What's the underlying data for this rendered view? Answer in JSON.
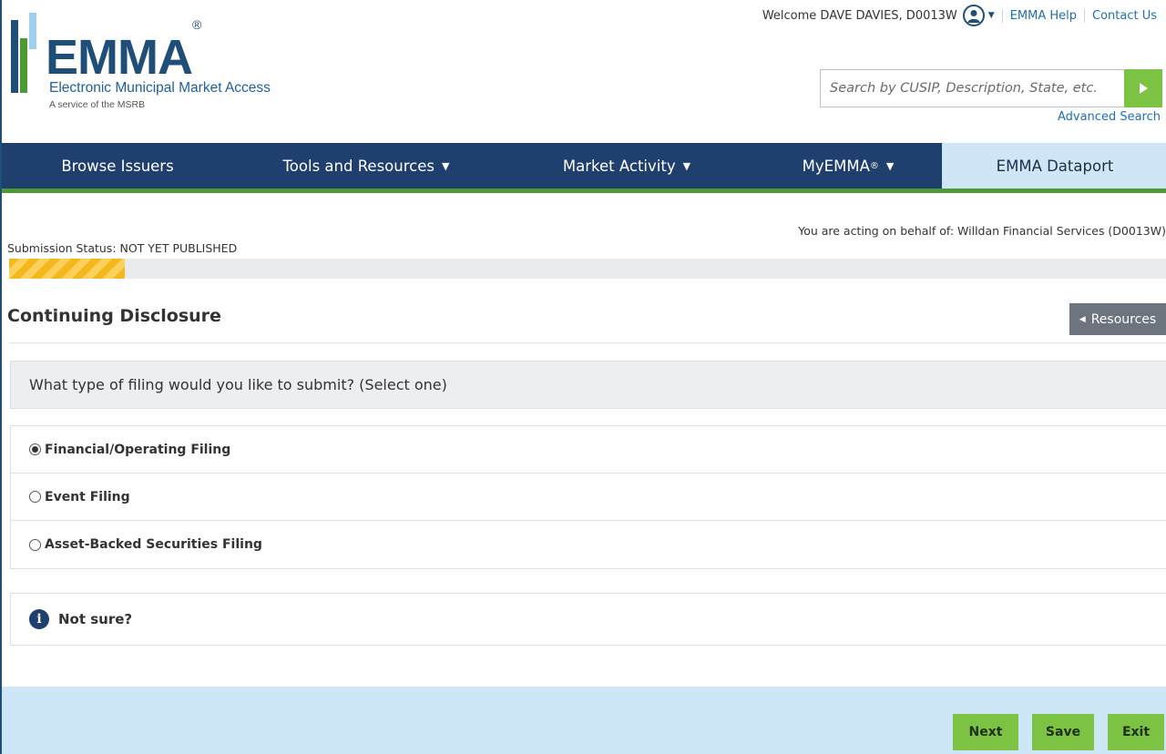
{
  "header": {
    "logo_text": "EMMA",
    "logo_reg": "®",
    "logo_subtitle": "Electronic Municipal Market Access",
    "logo_tagline": "A service of the MSRB",
    "welcome": "Welcome DAVE DAVIES, D0013W",
    "links": [
      "EMMA Help",
      "Contact Us"
    ],
    "search_placeholder": "Search by CUSIP, Description, State, etc.",
    "advanced_search": "Advanced Search"
  },
  "nav": {
    "items": [
      {
        "label": "Browse Issuers",
        "dropdown": false
      },
      {
        "label": "Tools and Resources",
        "dropdown": true
      },
      {
        "label": "Market Activity",
        "dropdown": true
      },
      {
        "label": "MyEMMA",
        "sup": "®",
        "dropdown": true
      },
      {
        "label": "EMMA Dataport",
        "dropdown": false,
        "active": true
      }
    ],
    "dropdown_glyph": "▼"
  },
  "behalf": "You are acting on behalf of: Willdan Financial Services (D0013W)",
  "submission": {
    "status": "Submission Status: NOT YET PUBLISHED",
    "progress_fraction": 0.1
  },
  "section": {
    "title": "Continuing Disclosure",
    "resources_label": "Resources",
    "question": "What type of filing would you like to submit? (Select one)",
    "options": [
      {
        "label": "Financial/Operating Filing",
        "selected": true
      },
      {
        "label": "Event Filing",
        "selected": false
      },
      {
        "label": "Asset-Backed Securities Filing",
        "selected": false
      }
    ],
    "not_sure": "Not sure?"
  },
  "footer": {
    "next": "Next",
    "save": "Save",
    "exit": "Exit"
  },
  "colors": {
    "navy": "#1f3f6e",
    "green": "#7cc243",
    "light_blue": "#cfe6f7"
  }
}
